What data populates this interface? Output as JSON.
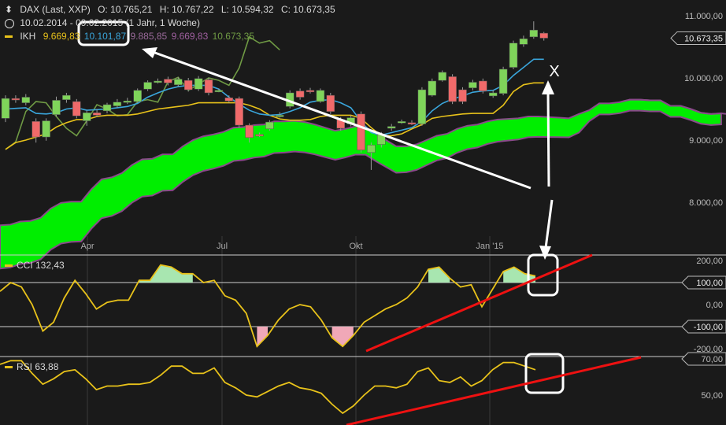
{
  "header": {
    "instrument": "DAX (Last, XXP)",
    "open": "O: 10.765,21",
    "high": "H: 10.767,22",
    "low": "L: 10.594,32",
    "close": "C: 10.673,35",
    "period": "10.02.2014 - 09.02.2015 (1 Jahr, 1 Woche)",
    "ikh_label": "IKH",
    "ikh_values": [
      "9.669,83",
      "10.101,87",
      "9.885,85",
      "9.669,83",
      "10.673,35"
    ]
  },
  "colors": {
    "background": "#1a1a1a",
    "up_candle": "#7fd45a",
    "down_candle": "#f06a6a",
    "cloud": "#00ee00",
    "tenkan": "#3aa6dc",
    "kijun": "#e8c21a",
    "chikou": "#6f9a44",
    "senkou": "#8a4a8a",
    "indicator": "#e8c21a",
    "annotation_red": "#ee1111",
    "annotation_white": "#ffffff"
  },
  "chart_data": [
    {
      "type": "candlestick",
      "title": "DAX (Last, XXP)",
      "y_ticks": [
        "11.000,00",
        "10.000,00",
        "9.000,00",
        "8.000,00"
      ],
      "y_tick_values": [
        11000,
        10000,
        9000,
        8000
      ],
      "x_ticks": [
        "Apr",
        "Jul",
        "Okt",
        "Jan '15"
      ],
      "last_price_label": "10.673,35",
      "ylim": [
        7630,
        11200
      ],
      "candles": [
        {
          "o": 9350,
          "c": 9670,
          "h": 9720,
          "l": 9290
        },
        {
          "o": 9670,
          "c": 9660,
          "h": 9720,
          "l": 9600
        },
        {
          "o": 9600,
          "c": 9690,
          "h": 9740,
          "l": 9560
        },
        {
          "o": 9300,
          "c": 9050,
          "h": 9350,
          "l": 8960
        },
        {
          "o": 9050,
          "c": 9310,
          "h": 9350,
          "l": 8990
        },
        {
          "o": 9410,
          "c": 9640,
          "h": 9700,
          "l": 9380
        },
        {
          "o": 9650,
          "c": 9720,
          "h": 9760,
          "l": 9600
        },
        {
          "o": 9620,
          "c": 9390,
          "h": 9660,
          "l": 9350
        },
        {
          "o": 9310,
          "c": 9440,
          "h": 9480,
          "l": 9230
        },
        {
          "o": 9440,
          "c": 9400,
          "h": 9500,
          "l": 9370
        },
        {
          "o": 9470,
          "c": 9570,
          "h": 9600,
          "l": 9430
        },
        {
          "o": 9550,
          "c": 9610,
          "h": 9660,
          "l": 9520
        },
        {
          "o": 9610,
          "c": 9630,
          "h": 9680,
          "l": 9580
        },
        {
          "o": 9620,
          "c": 9800,
          "h": 9830,
          "l": 9600
        },
        {
          "o": 9820,
          "c": 9930,
          "h": 9960,
          "l": 9790
        },
        {
          "o": 9930,
          "c": 9950,
          "h": 9990,
          "l": 9910
        },
        {
          "o": 9980,
          "c": 9920,
          "h": 10020,
          "l": 9880
        },
        {
          "o": 9890,
          "c": 9980,
          "h": 10010,
          "l": 9860
        },
        {
          "o": 9960,
          "c": 9810,
          "h": 10000,
          "l": 9780
        },
        {
          "o": 9820,
          "c": 9990,
          "h": 10030,
          "l": 9790
        },
        {
          "o": 9970,
          "c": 9760,
          "h": 10000,
          "l": 9720
        },
        {
          "o": 9790,
          "c": 9800,
          "h": 9830,
          "l": 9770
        },
        {
          "o": 9680,
          "c": 9630,
          "h": 9720,
          "l": 9600
        },
        {
          "o": 9670,
          "c": 9240,
          "h": 9700,
          "l": 9200
        },
        {
          "o": 9240,
          "c": 9040,
          "h": 9270,
          "l": 8960
        },
        {
          "o": 9090,
          "c": 9070,
          "h": 9120,
          "l": 9050
        },
        {
          "o": 9180,
          "c": 9290,
          "h": 9320,
          "l": 9150
        },
        {
          "o": 9400,
          "c": 9400,
          "h": 9450,
          "l": 9360
        },
        {
          "o": 9540,
          "c": 9760,
          "h": 9800,
          "l": 9510
        },
        {
          "o": 9790,
          "c": 9690,
          "h": 9830,
          "l": 9650
        },
        {
          "o": 9800,
          "c": 9780,
          "h": 9840,
          "l": 9750
        },
        {
          "o": 9620,
          "c": 9800,
          "h": 9830,
          "l": 9600
        },
        {
          "o": 9720,
          "c": 9460,
          "h": 9760,
          "l": 9420
        },
        {
          "o": 9330,
          "c": 9190,
          "h": 9370,
          "l": 9150
        },
        {
          "o": 9260,
          "c": 9360,
          "h": 9400,
          "l": 9220
        },
        {
          "o": 9420,
          "c": 8840,
          "h": 9460,
          "l": 8800
        },
        {
          "o": 8800,
          "c": 8920,
          "h": 8960,
          "l": 8520
        },
        {
          "o": 8930,
          "c": 9090,
          "h": 9130,
          "l": 8880
        },
        {
          "o": 9190,
          "c": 9220,
          "h": 9260,
          "l": 9150
        },
        {
          "o": 9280,
          "c": 9300,
          "h": 9330,
          "l": 9260
        },
        {
          "o": 9280,
          "c": 9260,
          "h": 9320,
          "l": 9240
        },
        {
          "o": 9260,
          "c": 9810,
          "h": 9850,
          "l": 9230
        },
        {
          "o": 9720,
          "c": 9950,
          "h": 9990,
          "l": 9700
        },
        {
          "o": 9960,
          "c": 10090,
          "h": 10120,
          "l": 9940
        },
        {
          "o": 10020,
          "c": 9620,
          "h": 10060,
          "l": 9580
        },
        {
          "o": 9810,
          "c": 9620,
          "h": 9850,
          "l": 9580
        },
        {
          "o": 9840,
          "c": 9930,
          "h": 9970,
          "l": 9800
        },
        {
          "o": 9950,
          "c": 9790,
          "h": 9990,
          "l": 9750
        },
        {
          "o": 9710,
          "c": 9760,
          "h": 9800,
          "l": 9680
        },
        {
          "o": 9750,
          "c": 10140,
          "h": 10180,
          "l": 9720
        },
        {
          "o": 10170,
          "c": 10560,
          "h": 10600,
          "l": 10140
        },
        {
          "o": 10540,
          "c": 10630,
          "h": 10680,
          "l": 10500
        },
        {
          "o": 10660,
          "c": 10770,
          "h": 10910,
          "l": 10630
        },
        {
          "o": 10720,
          "c": 10640,
          "h": 10740,
          "l": 10600
        }
      ],
      "series": [
        {
          "name": "Tenkan",
          "values": [
            9500,
            9510,
            9520,
            9430,
            9420,
            9440,
            9500,
            9520,
            9480,
            9490,
            9500,
            9520,
            9540,
            9590,
            9690,
            9760,
            9820,
            9860,
            9880,
            9880,
            9880,
            9820,
            9690,
            9580,
            9480,
            9420,
            9400,
            9410,
            9460,
            9520,
            9610,
            9640,
            9650,
            9600,
            9520,
            9300,
            9120,
            9080,
            9120,
            9160,
            9200,
            9300,
            9470,
            9590,
            9660,
            9710,
            9770,
            9790,
            9800,
            9880,
            10040,
            10170,
            10300,
            10300
          ]
        },
        {
          "name": "Kijun",
          "values": [
            8850,
            8960,
            9000,
            9050,
            9100,
            9210,
            9280,
            9330,
            9330,
            9380,
            9400,
            9400,
            9400,
            9420,
            9460,
            9500,
            9520,
            9540,
            9560,
            9600,
            9600,
            9600,
            9600,
            9600,
            9560,
            9500,
            9400,
            9340,
            9320,
            9320,
            9330,
            9380,
            9400,
            9400,
            9400,
            9350,
            9200,
            9070,
            9070,
            9100,
            9180,
            9250,
            9350,
            9380,
            9400,
            9420,
            9430,
            9430,
            9430,
            9560,
            9780,
            9890,
            9920,
            9920
          ]
        },
        {
          "name": "Chikou",
          "values": [
            8850,
            8970,
            9460,
            9620,
            9600,
            9380,
            9190,
            9070,
            9310,
            9570,
            9500,
            9390,
            9410,
            9620,
            9650,
            9610,
            9940,
            10010,
            9800,
            9900,
            10000,
            9960,
            9880,
            10160,
            10660,
            10560,
            10600,
            10450
          ]
        },
        {
          "name": "Senkou A",
          "values": [
            7630,
            7640,
            7690,
            7700,
            7750,
            7900,
            7990,
            8010,
            8010,
            8210,
            8370,
            8400,
            8470,
            8600,
            8690,
            8700,
            8770,
            8770,
            8900,
            9000,
            9060,
            9090,
            9130,
            9200,
            9210,
            9240,
            9250,
            9300,
            9300,
            9310,
            9290,
            9250,
            9200,
            9150,
            9180,
            9220,
            9210,
            9100,
            9000,
            8900,
            8900,
            8930,
            9000,
            9070,
            9100,
            9180,
            9230,
            9250,
            9300,
            9330,
            9340,
            9350,
            9380,
            9380,
            9370,
            9360,
            9350,
            9420,
            9480,
            9590,
            9590,
            9610,
            9650,
            9650,
            9640,
            9640,
            9550,
            9550,
            9500,
            9440,
            9420,
            9430
          ]
        },
        {
          "name": "Senkou B",
          "values": [
            7630,
            7640,
            7690,
            7700,
            7750,
            7900,
            7990,
            8010,
            8010,
            8210,
            8370,
            8400,
            8470,
            8600,
            8690,
            8700,
            8770,
            8770,
            8900,
            9000,
            9060,
            9090,
            9130,
            9200,
            9210,
            9240,
            9250,
            9300,
            9300,
            9310,
            9250,
            9220,
            9150,
            9150,
            9150,
            9150,
            9150,
            9080,
            9000,
            8900,
            8900,
            8930,
            9000,
            9040,
            9080,
            9120,
            9150,
            9150,
            9180,
            9200,
            9200,
            9200,
            9220,
            9250,
            9260,
            9300,
            9330,
            9360,
            9420,
            9420,
            9420,
            9420,
            9420,
            9420,
            9420,
            9420,
            9440,
            9440,
            9440,
            9440,
            9420,
            9430
          ]
        }
      ],
      "annotation": "X"
    },
    {
      "type": "line",
      "title": "CCI",
      "series_label": "CCI 132,43",
      "y_ticks": [
        "200,00",
        "0,00",
        "-200,00"
      ],
      "y_tick_values": [
        200,
        0,
        -200
      ],
      "reference_labels": [
        "100,00",
        "-100,00"
      ],
      "reference_values": [
        100,
        -100
      ],
      "ylim": [
        -230,
        230
      ],
      "values": [
        60,
        100,
        80,
        0,
        -120,
        -80,
        30,
        110,
        50,
        -20,
        10,
        20,
        20,
        110,
        110,
        180,
        170,
        140,
        140,
        100,
        110,
        40,
        20,
        -40,
        -190,
        -140,
        -70,
        -20,
        0,
        -10,
        -70,
        -150,
        -190,
        -140,
        -80,
        -50,
        -20,
        0,
        30,
        80,
        160,
        170,
        120,
        80,
        90,
        -10,
        70,
        150,
        170,
        140,
        130
      ]
    },
    {
      "type": "line",
      "title": "RSI",
      "series_label": "RSI 63,88",
      "y_ticks": [
        "70,00",
        "50,00"
      ],
      "y_tick_values": [
        70,
        50
      ],
      "ylim": [
        30,
        75
      ],
      "values": [
        67,
        69,
        69,
        62,
        56,
        59,
        63,
        64,
        59,
        53,
        55,
        55,
        56,
        56,
        57,
        61,
        66,
        66,
        62,
        62,
        65,
        57,
        54,
        50,
        49,
        52,
        55,
        57,
        54,
        53,
        51,
        45,
        40,
        44,
        50,
        55,
        55,
        54,
        56,
        63,
        65,
        58,
        57,
        60,
        55,
        58,
        64,
        68,
        68,
        66,
        64
      ]
    }
  ]
}
